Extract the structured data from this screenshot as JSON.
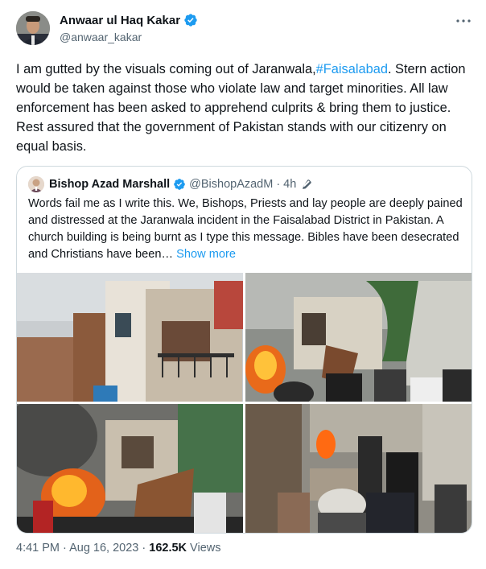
{
  "author": {
    "display_name": "Anwaar ul Haq Kakar",
    "handle": "@anwaar_kakar",
    "verified": true
  },
  "tweet": {
    "text_part1": "I am gutted by the visuals coming out of Jaranwala,",
    "hashtag": "#Faisalabad",
    "text_part2": ". Stern action would be taken against those who violate law and target minorities. All law enforcement has been asked to apprehend culprits & bring them to justice. Rest assured that the government of Pakistan stands with our citizenry on equal basis."
  },
  "quoted_tweet": {
    "display_name": "Bishop Azad Marshall",
    "handle": "@BishopAzadM",
    "separator": "·",
    "time": "4h",
    "text": "Words fail me as I write this. We, Bishops, Priests and lay people are deeply pained and distressed at the Jaranwala incident in the Faisalabad District in Pakistan. A church building is being burnt as I type this message. Bibles have been desecrated and Christians have been… ",
    "show_more": "Show more"
  },
  "meta": {
    "time": "4:41 PM",
    "sep1": " · ",
    "date": "Aug 16, 2023",
    "sep2": " · ",
    "views": "162.5K",
    "views_label": " Views"
  },
  "icons": {
    "verified": "verified-badge-icon",
    "more": "more-dots-icon",
    "edit": "edited-pencil-icon"
  },
  "colors": {
    "accent": "#1d9bf0",
    "secondary_text": "#536471",
    "border": "#cfd9de",
    "primary_text": "#0f1419"
  }
}
